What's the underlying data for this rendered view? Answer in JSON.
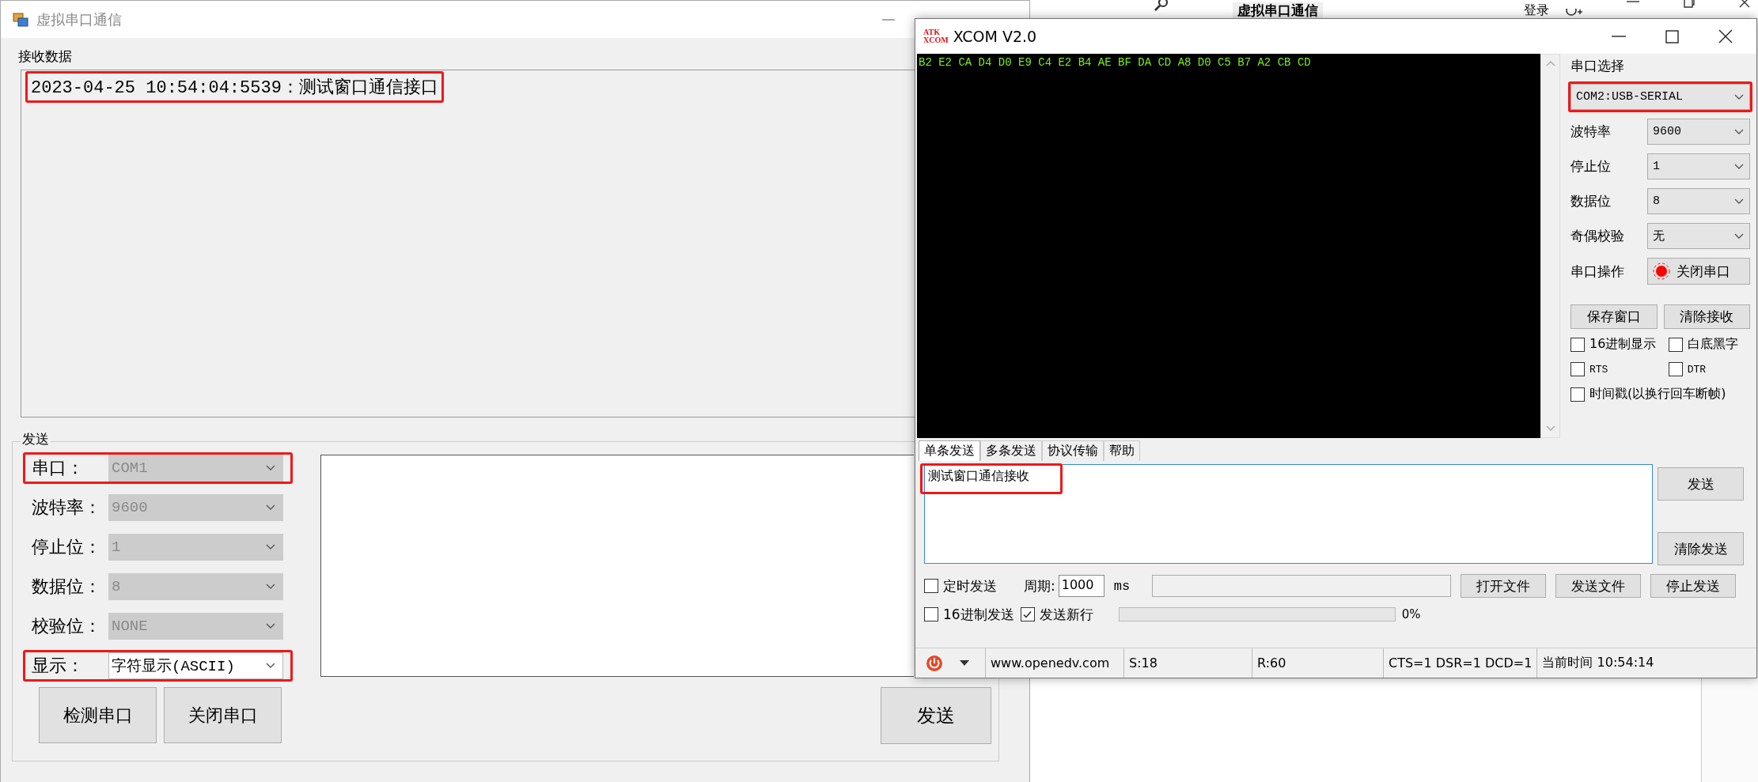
{
  "background_window": {
    "title": "虚拟串口通信",
    "login": "登录"
  },
  "main_window": {
    "title": "虚拟串口通信",
    "receive_group": {
      "label": "接收数据",
      "lines": [
        {
          "text": "2023-04-25 10:54:04:5539：测试窗口通信接口",
          "highlighted": true
        }
      ]
    },
    "send_group": {
      "label": "发送",
      "settings": [
        {
          "label": "串口：",
          "value": "COM1",
          "disabled": true,
          "highlighted": true
        },
        {
          "label": "波特率：",
          "value": "9600",
          "disabled": true,
          "highlighted": false
        },
        {
          "label": "停止位：",
          "value": "1",
          "disabled": true,
          "highlighted": false
        },
        {
          "label": "数据位：",
          "value": "8",
          "disabled": true,
          "highlighted": false
        },
        {
          "label": "校验位：",
          "value": "NONE",
          "disabled": true,
          "highlighted": false
        },
        {
          "label": "显示：",
          "value": "字符显示(ASCII)",
          "disabled": false,
          "highlighted": true
        }
      ],
      "buttons": [
        "检测串口",
        "关闭串口"
      ],
      "send_button": "发送"
    }
  },
  "xcom_window": {
    "title": "XCOM V2.0",
    "logo": [
      "ATK",
      "XCOM"
    ],
    "receive_text": "B2 E2 CA D4 D0 E9 C4 E2 B4 AE BF DA CD A8 D0 C5 B7 A2 CB CD",
    "panel": {
      "port_label": "串口选择",
      "port": {
        "value": "COM2:USB-SERIAL",
        "highlighted": true
      },
      "settings": [
        {
          "label": "波特率",
          "value": "9600"
        },
        {
          "label": "停止位",
          "value": "1"
        },
        {
          "label": "数据位",
          "value": "8"
        },
        {
          "label": "奇偶校验",
          "value": "无"
        }
      ],
      "operation": {
        "label": "串口操作",
        "button": "关闭串口"
      },
      "buttons": [
        "保存窗口",
        "清除接收"
      ],
      "checkboxes": [
        {
          "label": "16进制显示",
          "checked": false
        },
        {
          "label": "白底黑字",
          "checked": false
        },
        {
          "label": "RTS",
          "checked": false
        },
        {
          "label": "DTR",
          "checked": false
        },
        {
          "label": "时间戳(以换行回车断帧)",
          "checked": false
        }
      ]
    },
    "tabs": [
      {
        "label": "单条发送",
        "selected": true
      },
      {
        "label": "多条发送",
        "selected": false
      },
      {
        "label": "协议传输",
        "selected": false
      },
      {
        "label": "帮助",
        "selected": false
      }
    ],
    "send_text": {
      "value": "测试窗口通信接收",
      "highlighted": true
    },
    "send_buttons": [
      "发送",
      "清除发送"
    ],
    "timed_send": {
      "label": "定时发送",
      "checked": false
    },
    "period_label": "周期:",
    "period": "1000",
    "period_unit": "ms",
    "file_buttons": [
      "打开文件",
      "发送文件",
      "停止发送"
    ],
    "hex_send": {
      "label": "16进制发送",
      "checked": false
    },
    "newline": {
      "label": "发送新行",
      "checked": true
    },
    "progress": {
      "level": 0,
      "reading": "0%"
    },
    "status_bar": [
      "www.openedv.com",
      "S:18",
      "R:60",
      "CTS=1 DSR=1 DCD=1",
      "当前时间 10:54:14"
    ]
  }
}
